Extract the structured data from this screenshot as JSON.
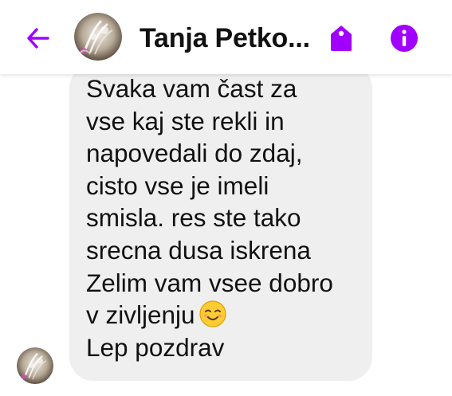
{
  "header": {
    "back_icon": "arrow-left-icon",
    "contact_name": "Tanja Petko...",
    "tag_icon": "tag-icon",
    "info_icon": "info-icon",
    "accent_color": "#a100ff"
  },
  "message": {
    "lines": [
      "Svaka vam čast za",
      "vse kaj ste rekli in",
      "napovedali do zdaj,",
      "cisto vse je imeli",
      "smisla. res ste tako",
      "srecna dusa iskrena",
      "Zelim vam vsee dobro",
      "v zivljenju",
      "Lep pozdrav"
    ],
    "emoji_icon": "smiling-face-emoji-icon",
    "bubble_color": "#efefef"
  }
}
